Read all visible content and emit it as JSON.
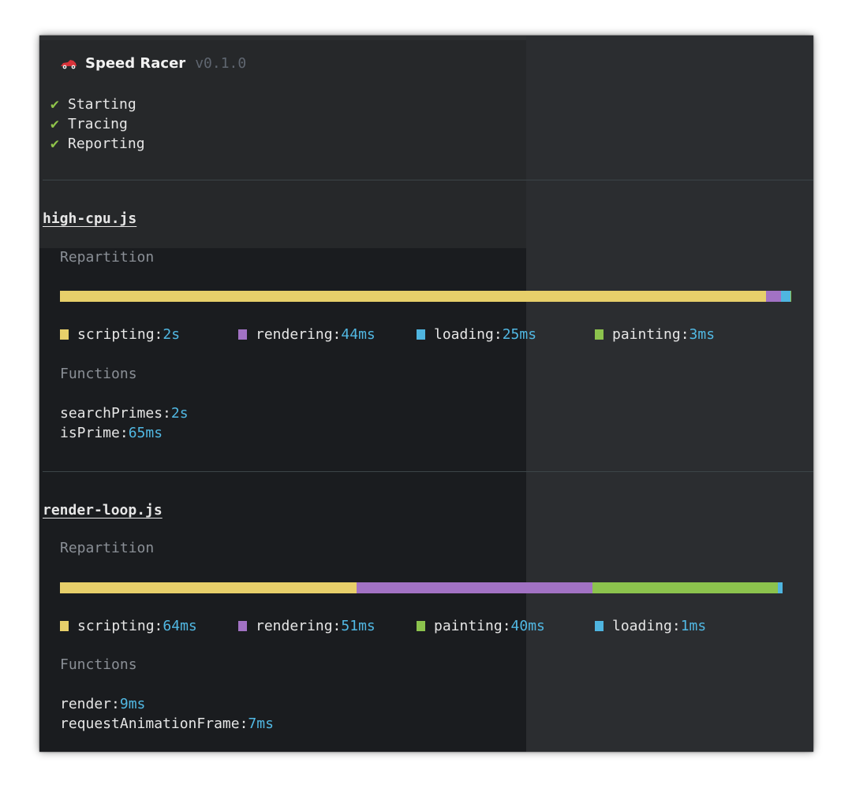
{
  "app": {
    "title": "Speed Racer",
    "version": "v0.1.0"
  },
  "steps": [
    {
      "label": "Starting"
    },
    {
      "label": "Tracing"
    },
    {
      "label": "Reporting"
    }
  ],
  "colors": {
    "scripting": "#e7cf6a",
    "rendering": "#a272c4",
    "loading": "#4fb5e0",
    "painting": "#8cc34d",
    "value": "#51b8e3",
    "check": "#8fc34a"
  },
  "reports": [
    {
      "file": "high-cpu.js",
      "repartition_label": "Repartition",
      "functions_label": "Functions",
      "bar": [
        {
          "category": "scripting",
          "ms": 2000
        },
        {
          "category": "rendering",
          "ms": 44
        },
        {
          "category": "loading",
          "ms": 25
        },
        {
          "category": "painting",
          "ms": 3
        }
      ],
      "legend": [
        {
          "name": "scripting",
          "value": "2s"
        },
        {
          "name": "rendering",
          "value": "44ms"
        },
        {
          "name": "loading",
          "value": "25ms"
        },
        {
          "name": "painting",
          "value": "3ms"
        }
      ],
      "functions": [
        {
          "name": "searchPrimes",
          "value": "2s"
        },
        {
          "name": "isPrime",
          "value": "65ms"
        }
      ]
    },
    {
      "file": "render-loop.js",
      "repartition_label": "Repartition",
      "functions_label": "Functions",
      "bar": [
        {
          "category": "scripting",
          "ms": 64
        },
        {
          "category": "rendering",
          "ms": 51
        },
        {
          "category": "painting",
          "ms": 40
        },
        {
          "category": "loading",
          "ms": 1
        }
      ],
      "legend": [
        {
          "name": "scripting",
          "value": "64ms"
        },
        {
          "name": "rendering",
          "value": "51ms"
        },
        {
          "name": "painting",
          "value": "40ms"
        },
        {
          "name": "loading",
          "value": "1ms"
        }
      ],
      "functions": [
        {
          "name": "render",
          "value": "9ms"
        },
        {
          "name": "requestAnimationFrame",
          "value": "7ms"
        }
      ]
    }
  ]
}
